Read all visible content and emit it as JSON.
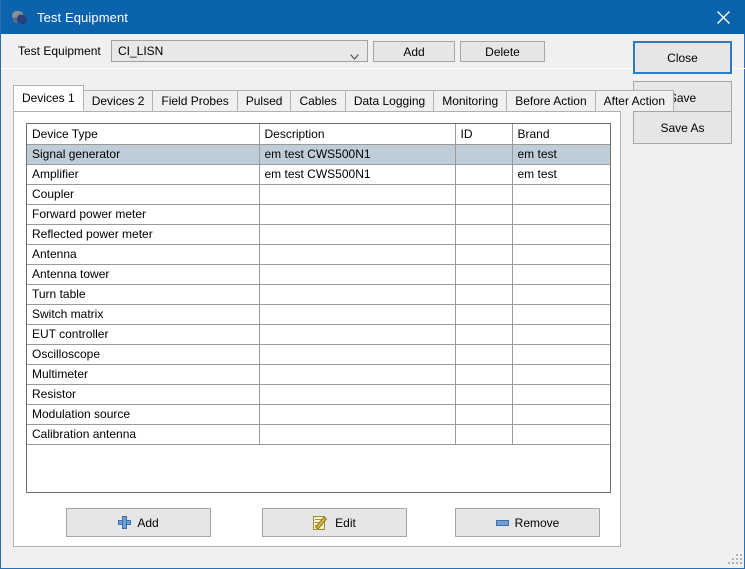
{
  "window": {
    "title": "Test Equipment",
    "title_icon": "equipment-icon",
    "close_icon": "close-icon"
  },
  "toolbar": {
    "label": "Test Equipment",
    "combo_value": "CI_LISN",
    "combo_arrow_icon": "chevron-down-icon",
    "add_label": "Add",
    "delete_label": "Delete"
  },
  "side_buttons": {
    "close_label": "Close",
    "save_label": "Save",
    "save_as_label": "Save As"
  },
  "tabs": [
    {
      "label": "Devices 1",
      "active": true
    },
    {
      "label": "Devices 2",
      "active": false
    },
    {
      "label": "Field Probes",
      "active": false
    },
    {
      "label": "Pulsed",
      "active": false
    },
    {
      "label": "Cables",
      "active": false
    },
    {
      "label": "Data Logging",
      "active": false
    },
    {
      "label": "Monitoring",
      "active": false
    },
    {
      "label": "Before Action",
      "active": false
    },
    {
      "label": "After Action",
      "active": false
    }
  ],
  "grid": {
    "columns": [
      "Device Type",
      "Description",
      "ID",
      "Brand"
    ],
    "rows": [
      {
        "device_type": "Signal generator",
        "description": "em test CWS500N1",
        "id": "",
        "brand": "em test",
        "selected": true
      },
      {
        "device_type": "Amplifier",
        "description": "em test CWS500N1",
        "id": "",
        "brand": "em test",
        "selected": false
      },
      {
        "device_type": "Coupler",
        "description": "",
        "id": "",
        "brand": "",
        "selected": false
      },
      {
        "device_type": "Forward power meter",
        "description": "",
        "id": "",
        "brand": "",
        "selected": false
      },
      {
        "device_type": "Reflected power meter",
        "description": "",
        "id": "",
        "brand": "",
        "selected": false
      },
      {
        "device_type": "Antenna",
        "description": "",
        "id": "",
        "brand": "",
        "selected": false
      },
      {
        "device_type": "Antenna tower",
        "description": "",
        "id": "",
        "brand": "",
        "selected": false
      },
      {
        "device_type": "Turn table",
        "description": "",
        "id": "",
        "brand": "",
        "selected": false
      },
      {
        "device_type": "Switch matrix",
        "description": "",
        "id": "",
        "brand": "",
        "selected": false
      },
      {
        "device_type": "EUT controller",
        "description": "",
        "id": "",
        "brand": "",
        "selected": false
      },
      {
        "device_type": "Oscilloscope",
        "description": "",
        "id": "",
        "brand": "",
        "selected": false
      },
      {
        "device_type": "Multimeter",
        "description": "",
        "id": "",
        "brand": "",
        "selected": false
      },
      {
        "device_type": "Resistor",
        "description": "",
        "id": "",
        "brand": "",
        "selected": false
      },
      {
        "device_type": "Modulation source",
        "description": "",
        "id": "",
        "brand": "",
        "selected": false
      },
      {
        "device_type": "Calibration antenna",
        "description": "",
        "id": "",
        "brand": "",
        "selected": false
      }
    ]
  },
  "actions": {
    "add_label": "Add",
    "add_icon": "plus-icon",
    "edit_label": "Edit",
    "edit_icon": "edit-notepad-icon",
    "remove_label": "Remove",
    "remove_icon": "minus-icon"
  },
  "colors": {
    "titlebar": "#0c63ad",
    "selection": "#bfcdd9",
    "focus_border": "#2b7cc4",
    "button_face": "#e6e6e6"
  }
}
